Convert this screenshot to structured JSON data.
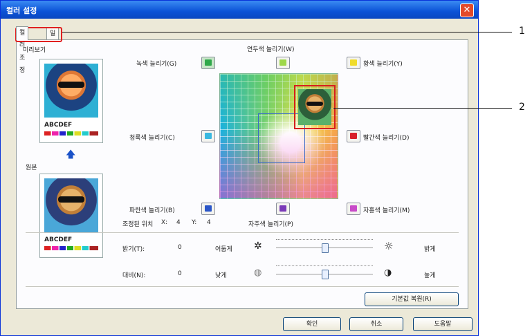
{
  "window": {
    "title": "컬러 설정",
    "close_glyph": "✕"
  },
  "tabs": [
    "컬러 조정",
    "일치"
  ],
  "preview_label": "미리보기",
  "original_label": "원본",
  "thumb_text": "ABCDEF",
  "grid_title": "연두색 늘리기(W)",
  "color_buttons": {
    "green": "녹색 늘리기(G)",
    "yellow": "황색 늘리기(Y)",
    "cyan": "청록색 늘리기(C)",
    "red": "빨간색 늘리기(D)",
    "blue": "파란색 늘리기(B)",
    "magenta": "자홍색 늘리기(M)",
    "purple": "자주색 늘리기(P)"
  },
  "position": {
    "label": "조정된 위치",
    "x_label": "X:",
    "x": "4",
    "y_label": "Y:",
    "y": "4"
  },
  "brightness": {
    "label": "밝기(T):",
    "value": "0",
    "low": "어둡게",
    "high": "밝게",
    "level": 0
  },
  "contrast": {
    "label": "대비(N):",
    "value": "0",
    "low": "낮게",
    "high": "높게",
    "level": 0
  },
  "buttons": {
    "defaults": "기본값 복원(R)",
    "ok": "확인",
    "cancel": "취소",
    "help": "도움말"
  },
  "callouts": [
    "1",
    "2"
  ],
  "colors": {
    "green": "#2fa84a",
    "yellow": "#f0dc2a",
    "cyan": "#3ab8e0",
    "red": "#d8202a",
    "blue": "#2b56c8",
    "magenta": "#c84ac8",
    "purple": "#7a3ab8",
    "lightgreen": "#9ed84a"
  }
}
